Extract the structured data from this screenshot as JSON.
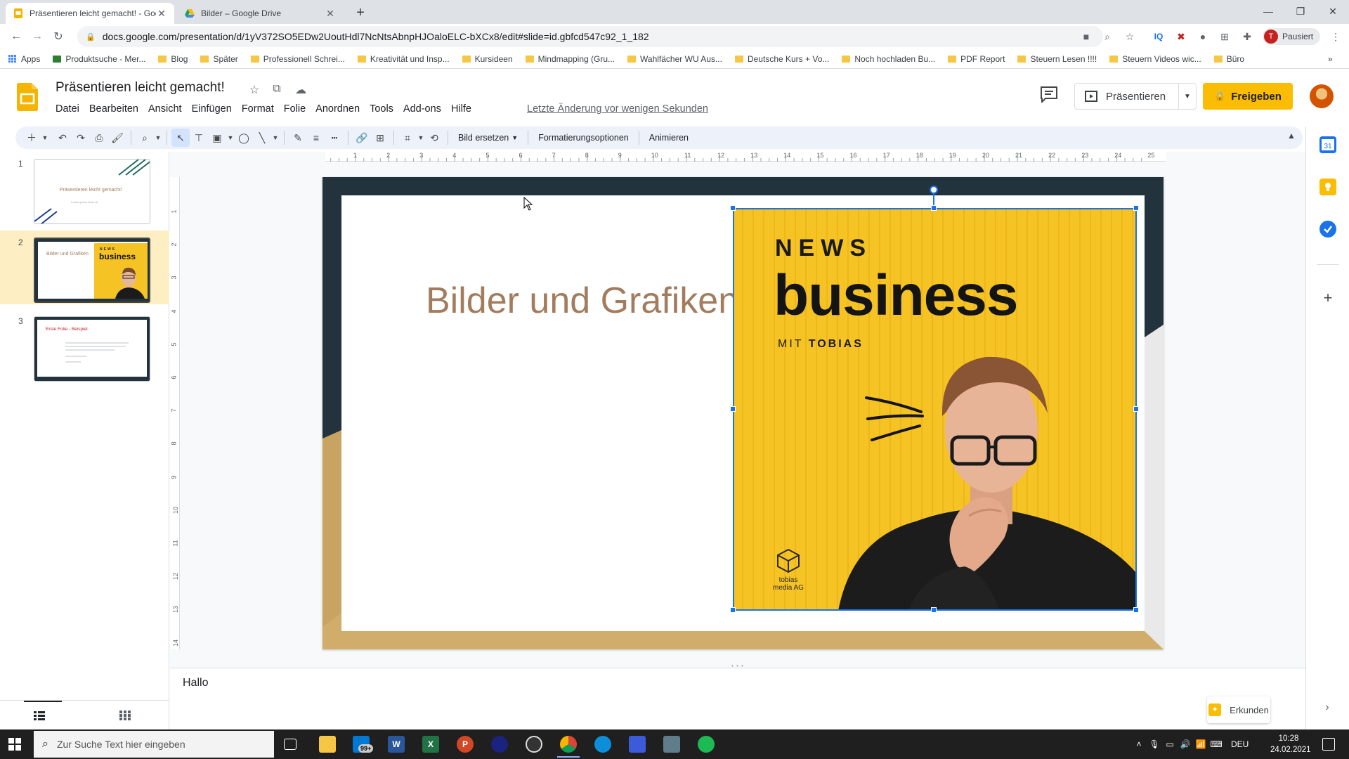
{
  "browser": {
    "tabs": [
      {
        "label": "Präsentieren leicht gemacht! - Google Präsentationen",
        "active": true
      },
      {
        "label": "Bilder – Google Drive",
        "active": false
      }
    ],
    "url": "docs.google.com/presentation/d/1yV372SO5EDw2UoutHdl7NcNtsAbnpHJOaloELC-bXCx8/edit#slide=id.gbfcd547c92_1_182",
    "profile_label": "Pausiert",
    "profile_initial": "T",
    "bookmarks": [
      "Apps",
      "Produktsuche - Mer...",
      "Blog",
      "Später",
      "Professionell Schrei...",
      "Kreativität und Insp...",
      "Kursideen",
      "Mindmapping (Gru...",
      "Wahlfächer WU Aus...",
      "Deutsche Kurs + Vo...",
      "Noch hochladen Bu...",
      "PDF Report",
      "Steuern Lesen !!!!",
      "Steuern Videos wic...",
      "Büro"
    ]
  },
  "app": {
    "title": "Präsentieren leicht gemacht!",
    "menu": [
      "Datei",
      "Bearbeiten",
      "Ansicht",
      "Einfügen",
      "Format",
      "Folie",
      "Anordnen",
      "Tools",
      "Add-ons",
      "Hilfe"
    ],
    "last_edit": "Letzte Änderung vor wenigen Sekunden",
    "present_label": "Präsentieren",
    "share_label": "Freigeben",
    "accent": "#fbbc04"
  },
  "toolbar": {
    "replace_image": "Bild ersetzen",
    "format_options": "Formatierungsoptionen",
    "animate": "Animieren"
  },
  "ruler": {
    "h_ticks": [
      "1",
      "2",
      "3",
      "4",
      "5",
      "6",
      "7",
      "8",
      "9",
      "10",
      "11",
      "12",
      "13",
      "14",
      "15",
      "16",
      "17",
      "18",
      "19",
      "20",
      "21",
      "22",
      "23",
      "24",
      "25"
    ],
    "v_ticks": [
      "1",
      "2",
      "3",
      "4",
      "5",
      "6",
      "7",
      "8",
      "9",
      "10",
      "11",
      "12",
      "13",
      "14"
    ]
  },
  "filmstrip": {
    "slides": [
      {
        "number": "1",
        "title": "Präsentieren leicht gemacht!",
        "subtitle": "Lorem ipsum dolor sit"
      },
      {
        "number": "2",
        "title": "Bilder und Grafiken",
        "image_heading": "business",
        "image_kicker": "NEWS"
      },
      {
        "number": "3",
        "title": "Erste Folie - Beispiel"
      }
    ]
  },
  "slide": {
    "title": "Bilder und Grafiken",
    "image": {
      "kicker": "NEWS",
      "heading": "business",
      "byline_prefix": "MIT",
      "byline_name": "TOBIAS",
      "brand_line1": "tobias",
      "brand_line2": "media AG",
      "bg_color": "#f6c325"
    }
  },
  "notes": {
    "text": "Hallo"
  },
  "explore_label": "Erkunden",
  "taskbar": {
    "search_placeholder": "Zur Suche Text hier eingeben",
    "mail_badge": "99+",
    "language": "DEU",
    "time": "10:28",
    "date": "24.02.2021"
  }
}
